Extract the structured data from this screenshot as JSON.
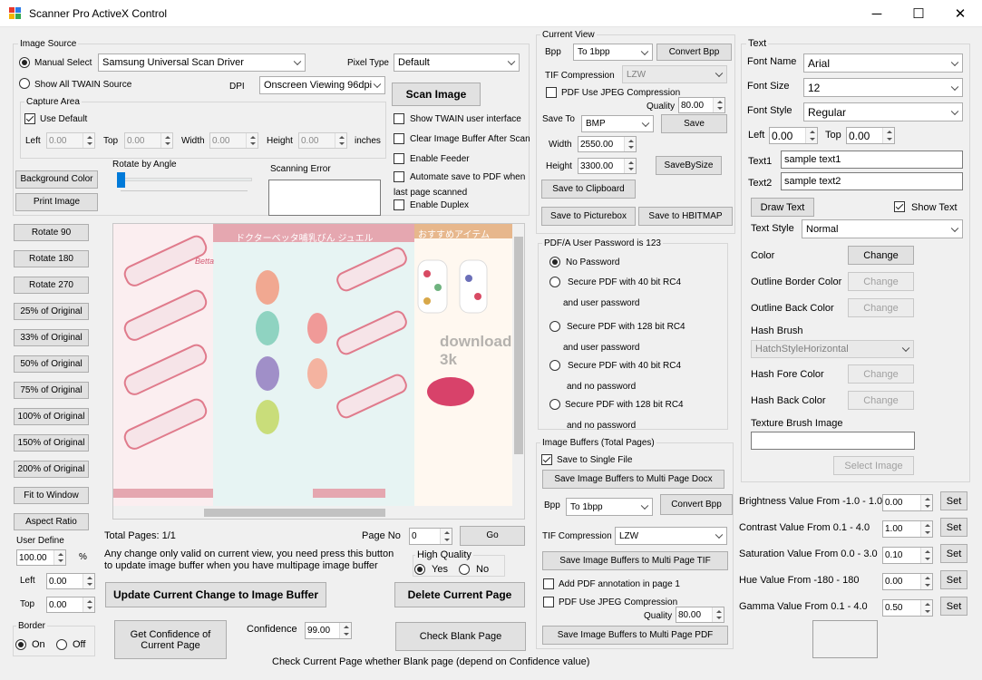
{
  "window": {
    "title": "Scanner Pro ActiveX Control",
    "minimize": "─",
    "maximize": "☐",
    "close": "✕"
  },
  "image_source": {
    "legend": "Image Source",
    "manual_select": "Manual Select",
    "show_all": "Show All TWAIN Source",
    "driver": "Samsung Universal Scan Driver",
    "pixel_type_label": "Pixel Type",
    "pixel_type": "Default",
    "dpi_label": "DPI",
    "dpi": "Onscreen Viewing 96dpi",
    "scan_button": "Scan Image",
    "show_twain_ui": "Show TWAIN user interface",
    "clear_buffer": "Clear Image Buffer After Scan",
    "enable_feeder": "Enable Feeder",
    "automate_save": "Automate save to PDF when",
    "last_page": "last page scanned",
    "enable_duplex": "Enable Duplex"
  },
  "capture_area": {
    "legend": "Capture Area",
    "use_default": "Use Default",
    "left_label": "Left",
    "left": "0.00",
    "top_label": "Top",
    "top": "0.00",
    "width_label": "Width",
    "width": "0.00",
    "height_label": "Height",
    "height": "0.00",
    "units": "inches"
  },
  "misc": {
    "background_color": "Background Color",
    "print_image": "Print Image",
    "rotate_by_angle": "Rotate by Angle",
    "scanning_error": "Scanning Error"
  },
  "left_buttons": [
    "Rotate 90",
    "Rotate 180",
    "Rotate 270",
    "25% of Original",
    "33% of Original",
    "50% of Original",
    "75% of Original",
    "100% of Original",
    "150% of Original",
    "200% of Original",
    "Fit to Window",
    "Aspect Ratio"
  ],
  "user_define": {
    "label": "User Define",
    "value": "100.00",
    "percent": "%",
    "left_label": "Left",
    "left": "0.00",
    "top_label": "Top",
    "top": "0.00"
  },
  "border": {
    "legend": "Border",
    "on": "On",
    "off": "Off"
  },
  "preview": {
    "sec1": "ドクターベッタ哺乳びん ジュエル",
    "sec2": "おすすめアイテム",
    "watermark": "download 3k",
    "brand": "Betta"
  },
  "bottom": {
    "total_pages": "Total Pages: 1/1",
    "page_no_label": "Page No",
    "page_no": "0",
    "go": "Go",
    "note": "Any change only valid on current view, you need press this button to update image buffer when you have multipage image buffer",
    "high_quality": "High Quality",
    "yes": "Yes",
    "no": "No",
    "update_button": "Update Current Change to Image Buffer",
    "delete_button": "Delete Current Page",
    "confidence_button": "Get Confidence of Current Page",
    "confidence_label": "Confidence",
    "confidence": "99.00",
    "check_blank": "Check Blank Page",
    "check_note": "Check Current Page whether Blank page (depend on Confidence value)"
  },
  "current_view": {
    "legend": "Current View",
    "bpp_label": "Bpp",
    "bpp": "To 1bpp",
    "convert_bpp": "Convert Bpp",
    "tif_label": "TIF Compression",
    "tif": "LZW",
    "pdf_jpeg": "PDF Use JPEG Compression",
    "quality_label": "Quality",
    "quality": "80.00",
    "save_to_label": "Save To",
    "save_to": "BMP",
    "save": "Save",
    "width_label": "Width",
    "width": "2550.00",
    "height_label": "Height",
    "height": "3300.00",
    "save_by_size": "SaveBySize",
    "save_clipboard": "Save to Clipboard",
    "save_picturebox": "Save to Picturebox",
    "save_hbitmap": "Save to HBITMAP"
  },
  "pdfa": {
    "legend": "PDF/A User Password is 123",
    "options": [
      "No Password",
      "Secure PDF with 40 bit RC4",
      "Secure PDF with 128 bit RC4",
      "Secure PDF with 40 bit RC4",
      "Secure PDF with 128 bit RC4"
    ],
    "sub": [
      "and user password",
      "and user password",
      "and no password",
      "and no password"
    ]
  },
  "buffers": {
    "legend": "Image Buffers (Total Pages)",
    "single_file": "Save to Single File",
    "save_docx": "Save Image Buffers to Multi Page Docx",
    "bpp_label": "Bpp",
    "bpp": "To 1bpp",
    "convert_bpp": "Convert Bpp",
    "tif_label": "TIF Compression",
    "tif": "LZW",
    "save_tif": "Save Image Buffers to Multi Page TIF",
    "add_annotation": "Add PDF annotation in page 1",
    "pdf_jpeg": "PDF Use JPEG Compression",
    "quality_label": "Quality",
    "quality": "80.00",
    "save_pdf": "Save Image Buffers to Multi Page PDF"
  },
  "text": {
    "legend": "Text",
    "font_name_label": "Font Name",
    "font_name": "Arial",
    "font_size_label": "Font Size",
    "font_size": "12",
    "font_style_label": "Font Style",
    "font_style": "Regular",
    "left_label": "Left",
    "left": "0.00",
    "top_label": "Top",
    "top": "0.00",
    "text1_label": "Text1",
    "text1": "sample text1",
    "text2_label": "Text2",
    "text2": "sample text2",
    "draw_text": "Draw Text",
    "show_text": "Show Text",
    "text_style_label": "Text Style",
    "text_style": "Normal",
    "color_label": "Color",
    "change": "Change",
    "outline_border_label": "Outline Border Color",
    "outline_back_label": "Outline Back Color",
    "hash_brush_label": "Hash Brush",
    "hash_brush": "HatchStyleHorizontal",
    "hash_fore_label": "Hash Fore Color",
    "hash_back_label": "Hash Back Color",
    "texture_label": "Texture Brush Image",
    "select_image": "Select Image"
  },
  "adjust": {
    "rows": [
      {
        "label": "Brightness Value From -1.0 - 1.0",
        "value": "0.00",
        "set": "Set"
      },
      {
        "label": "Contrast Value From 0.1 - 4.0",
        "value": "1.00",
        "set": "Set"
      },
      {
        "label": "Saturation Value From 0.0 - 3.0",
        "value": "0.10",
        "set": "Set"
      },
      {
        "label": "Hue Value From -180 - 180",
        "value": "0.00",
        "set": "Set"
      },
      {
        "label": "Gamma Value From 0.1 - 4.0",
        "value": "0.50",
        "set": "Set"
      }
    ]
  }
}
